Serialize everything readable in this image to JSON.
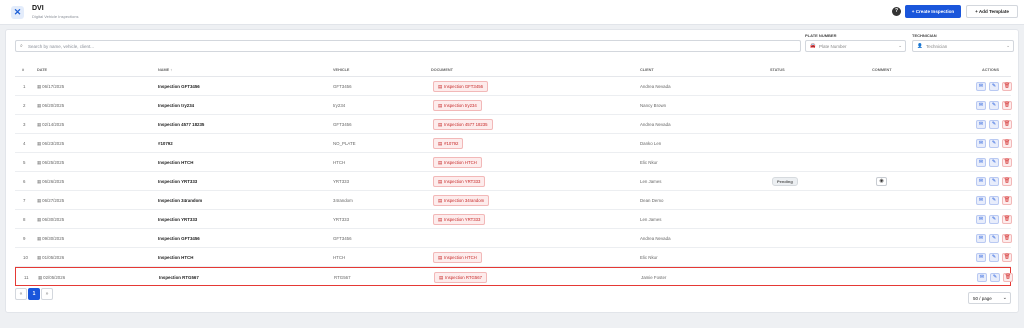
{
  "app": {
    "title": "DVI",
    "subtitle": "Digital Vehicle Inspections",
    "logo_icon": "wrench-cross-icon"
  },
  "header": {
    "help_icon": "?",
    "create_label": "+ Create Inspection",
    "template_label": "+ Add Template"
  },
  "filters": {
    "search_placeholder": "Search by name, vehicle, client...",
    "plate_label": "PLATE NUMBER",
    "plate_placeholder": "Plate Number",
    "technician_label": "TECHNICIAN",
    "technician_placeholder": "Technician"
  },
  "table": {
    "headers": {
      "num": "#",
      "date": "DATE",
      "name": "NAME ↑",
      "vehicle": "VEHICLE",
      "document": "DOCUMENT",
      "client": "CLIENT",
      "status": "STATUS",
      "comment": "COMMENT",
      "actions": "ACTIONS"
    },
    "rows": [
      {
        "num": "1",
        "date": "06/17/2025",
        "name": "Inspection GFT3456",
        "vehicle": "GFT3456",
        "document": "Inspection GFT3456",
        "client": "Andrea Nevada",
        "status": "",
        "comment": false
      },
      {
        "num": "2",
        "date": "06/20/2025",
        "name": "Inspection try234",
        "vehicle": "try234",
        "document": "Inspection try234",
        "client": "Nancy Brown",
        "status": "",
        "comment": false
      },
      {
        "num": "3",
        "date": "02/14/2025",
        "name": "Inspection 4577 18235",
        "vehicle": "GFT3456",
        "document": "Inspection 4577 18235",
        "client": "Andrea Nevada",
        "status": "",
        "comment": false
      },
      {
        "num": "4",
        "date": "06/23/2025",
        "name": "#10792",
        "vehicle": "NO_PLATE",
        "document": "#10792",
        "client": "Danko Len",
        "status": "",
        "comment": false
      },
      {
        "num": "5",
        "date": "06/25/2025",
        "name": "Inspection HTCH",
        "vehicle": "HTCH",
        "document": "Inspection HTCH",
        "client": "Elic Nkur",
        "status": "",
        "comment": false
      },
      {
        "num": "6",
        "date": "06/26/2025",
        "name": "Inspection YRT333",
        "vehicle": "YRT333",
        "document": "Inspection YRT333",
        "client": "Len James",
        "status": "Pending",
        "comment": true
      },
      {
        "num": "7",
        "date": "06/27/2025",
        "name": "Inspection 34random",
        "vehicle": "34random",
        "document": "Inspection 34random",
        "client": "Dean Demo",
        "status": "",
        "comment": false
      },
      {
        "num": "8",
        "date": "06/30/2025",
        "name": "Inspection YRT333",
        "vehicle": "YRT333",
        "document": "Inspection YRT333",
        "client": "Len James",
        "status": "",
        "comment": false
      },
      {
        "num": "9",
        "date": "09/30/2025",
        "name": "Inspection GFT3456",
        "vehicle": "GFT3456",
        "document": "",
        "client": "Andrea Nevada",
        "status": "",
        "comment": false
      },
      {
        "num": "10",
        "date": "01/05/2026",
        "name": "Inspection HTCH",
        "vehicle": "HTCH",
        "document": "Inspection HTCH",
        "client": "Elic Nkur",
        "status": "",
        "comment": false
      },
      {
        "num": "11",
        "date": "02/05/2026",
        "name": "Inspection RTG567",
        "vehicle": "RTG567",
        "document": "Inspection RTG567",
        "client": "Jamie Foster",
        "status": "",
        "comment": false,
        "selected": true
      }
    ]
  },
  "pagination": {
    "prev": "«",
    "current": "1",
    "next": "»",
    "page_size": "50 / page"
  },
  "colors": {
    "primary": "#1a56db",
    "danger": "#d32f2f",
    "selected_border": "#e53935"
  }
}
